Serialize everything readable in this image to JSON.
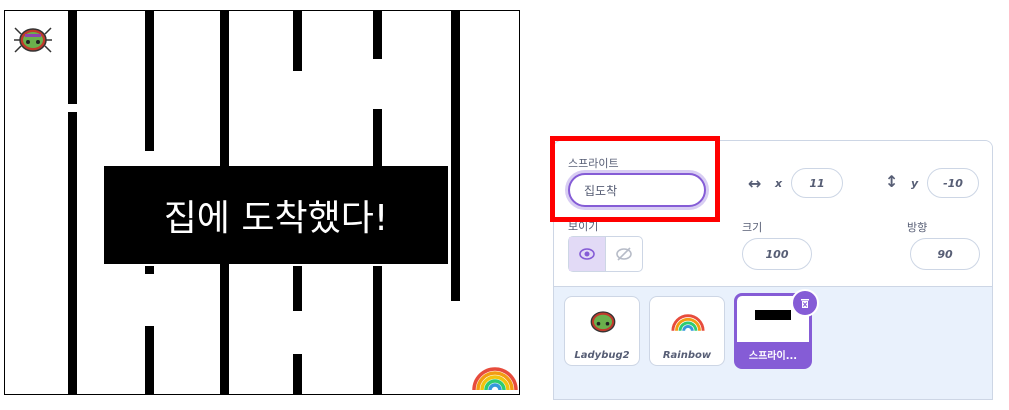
{
  "stage": {
    "win_message": "집에 도착했다!"
  },
  "sprite_info": {
    "name_label": "스프라이트",
    "name_value": "집도착",
    "x_label": "x",
    "x_value": "11",
    "y_label": "y",
    "y_value": "-10",
    "show_label": "보이기",
    "size_label": "크기",
    "size_value": "100",
    "direction_label": "방향",
    "direction_value": "90"
  },
  "sprites": [
    {
      "name": "Ladybug2",
      "icon": "ladybug-icon"
    },
    {
      "name": "Rainbow",
      "icon": "rainbow-icon"
    },
    {
      "name": "스프라이...",
      "icon": "sprite-thumbnail",
      "selected": true
    }
  ],
  "colors": {
    "accent": "#855cd6",
    "highlight": "#ff0000",
    "panel_bg": "#e9f1fc"
  }
}
